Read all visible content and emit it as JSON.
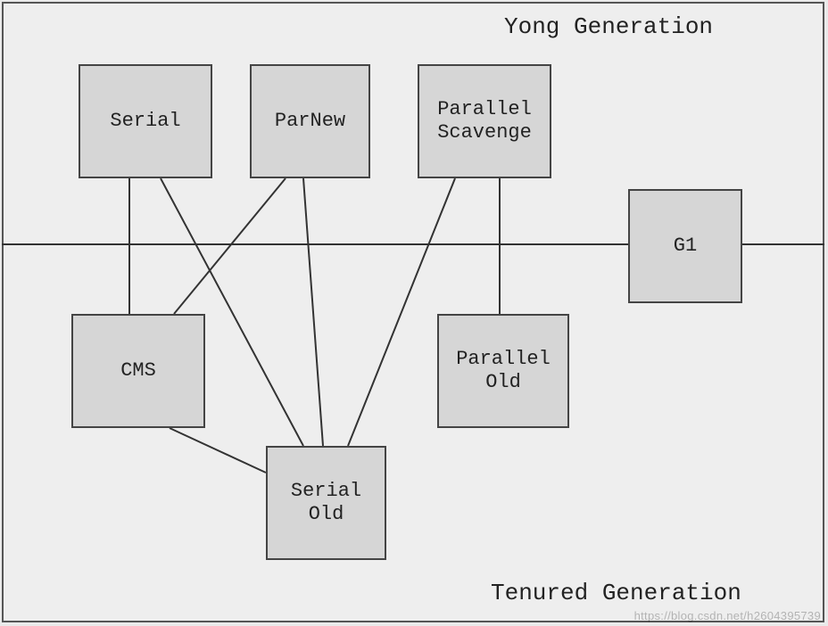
{
  "labels": {
    "young": "Yong Generation",
    "tenured": "Tenured Generation"
  },
  "nodes": {
    "serial": "Serial",
    "parnew": "ParNew",
    "parallel_scavenge": "Parallel\nScavenge",
    "g1": "G1",
    "cms": "CMS",
    "parallel_old": "Parallel\nOld",
    "serial_old": "Serial\nOld"
  },
  "edges": [
    [
      "serial",
      "cms"
    ],
    [
      "serial",
      "serial_old"
    ],
    [
      "parnew",
      "cms"
    ],
    [
      "parnew",
      "serial_old"
    ],
    [
      "parallel_scavenge",
      "parallel_old"
    ],
    [
      "parallel_scavenge",
      "serial_old"
    ],
    [
      "cms",
      "serial_old"
    ]
  ],
  "watermark": "https://blog.csdn.net/h2604395739"
}
